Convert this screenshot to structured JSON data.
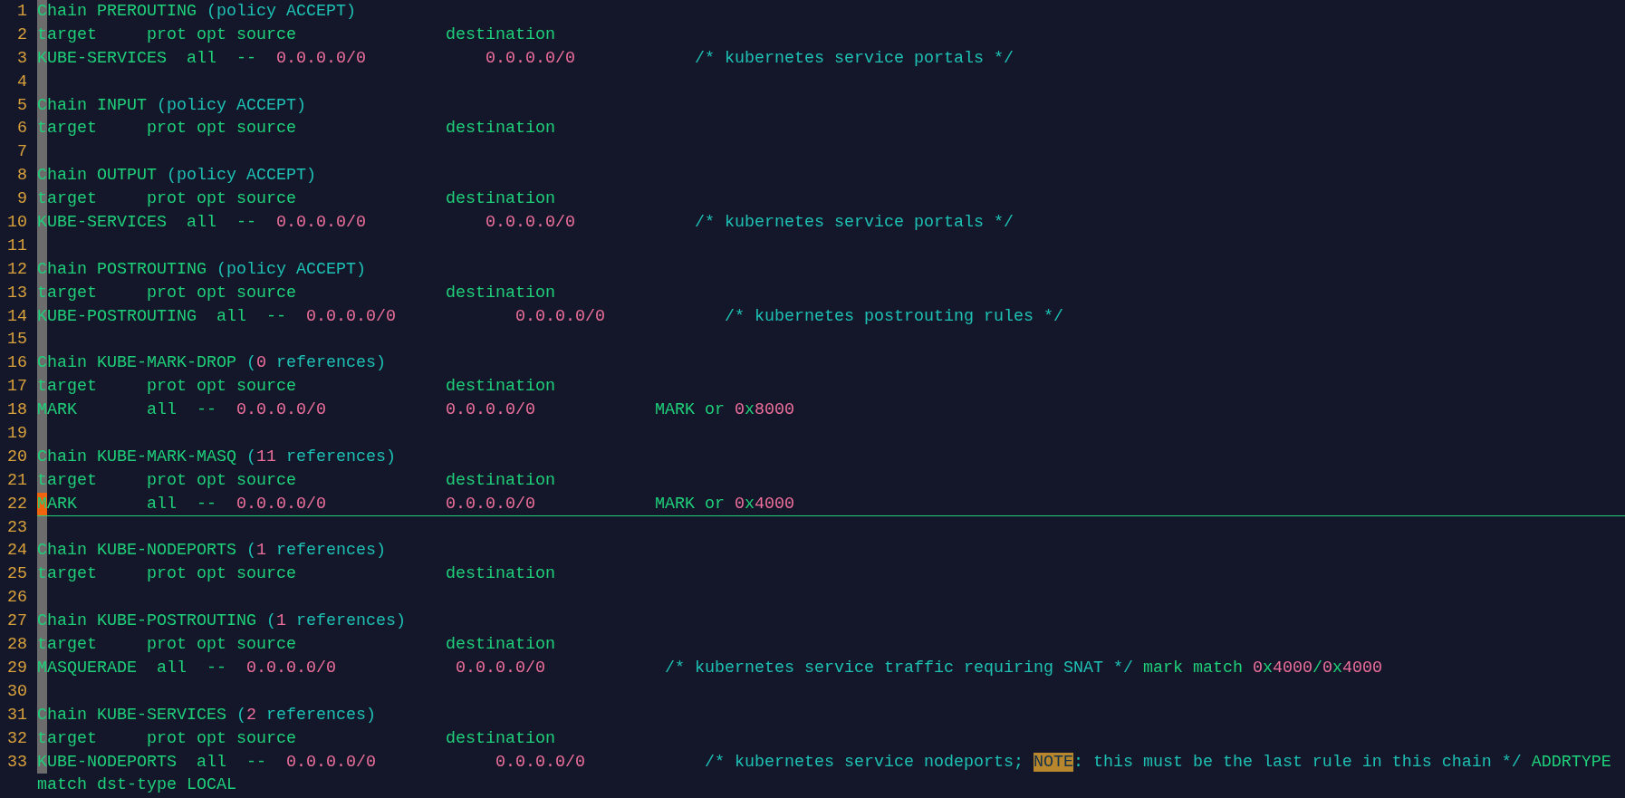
{
  "lines": [
    {
      "number": "1",
      "current": false,
      "tokens": [
        {
          "kind": "text",
          "t": "Chain PREROUTING "
        },
        {
          "kind": "comment",
          "t": "(policy ACCEPT)"
        }
      ]
    },
    {
      "number": "2",
      "current": false,
      "tokens": [
        {
          "kind": "text",
          "t": "target     prot opt source               destination"
        }
      ]
    },
    {
      "number": "3",
      "current": false,
      "tokens": [
        {
          "kind": "text",
          "t": "KUBE-SERVICES  all  --  "
        },
        {
          "kind": "number",
          "t": "0.0.0.0/0            "
        },
        {
          "kind": "number",
          "t": "0.0.0.0/0            "
        },
        {
          "kind": "comment",
          "t": "/* kubernetes service portals */"
        }
      ]
    },
    {
      "number": "4",
      "current": false
    },
    {
      "number": "5",
      "current": false,
      "tokens": [
        {
          "kind": "text",
          "t": "Chain INPUT "
        },
        {
          "kind": "comment",
          "t": "(policy ACCEPT)"
        }
      ]
    },
    {
      "number": "6",
      "current": false,
      "tokens": [
        {
          "kind": "text",
          "t": "target     prot opt source               destination"
        }
      ]
    },
    {
      "number": "7",
      "current": false
    },
    {
      "number": "8",
      "current": false,
      "tokens": [
        {
          "kind": "text",
          "t": "Chain OUTPUT "
        },
        {
          "kind": "comment",
          "t": "(policy ACCEPT)"
        }
      ]
    },
    {
      "number": "9",
      "current": false,
      "tokens": [
        {
          "kind": "text",
          "t": "target     prot opt source               destination"
        }
      ]
    },
    {
      "number": "10",
      "current": false,
      "tokens": [
        {
          "kind": "text",
          "t": "KUBE-SERVICES  all  --  "
        },
        {
          "kind": "number",
          "t": "0.0.0.0/0            "
        },
        {
          "kind": "number",
          "t": "0.0.0.0/0            "
        },
        {
          "kind": "comment",
          "t": "/* kubernetes service portals */"
        }
      ]
    },
    {
      "number": "11",
      "current": false
    },
    {
      "number": "12",
      "current": false,
      "tokens": [
        {
          "kind": "text",
          "t": "Chain POSTROUTING "
        },
        {
          "kind": "comment",
          "t": "(policy ACCEPT)"
        }
      ]
    },
    {
      "number": "13",
      "current": false,
      "tokens": [
        {
          "kind": "text",
          "t": "target     prot opt source               destination"
        }
      ]
    },
    {
      "number": "14",
      "current": false,
      "tokens": [
        {
          "kind": "text",
          "t": "KUBE-POSTROUTING  all  --  "
        },
        {
          "kind": "number",
          "t": "0.0.0.0/0            "
        },
        {
          "kind": "number",
          "t": "0.0.0.0/0            "
        },
        {
          "kind": "comment",
          "t": "/* kubernetes postrouting rules */"
        }
      ]
    },
    {
      "number": "15",
      "current": false
    },
    {
      "number": "16",
      "current": false,
      "tokens": [
        {
          "kind": "text",
          "t": "Chain KUBE-MARK-DROP "
        },
        {
          "kind": "comment",
          "t": "("
        },
        {
          "kind": "number",
          "t": "0"
        },
        {
          "kind": "comment",
          "t": " references)"
        }
      ]
    },
    {
      "number": "17",
      "current": false,
      "tokens": [
        {
          "kind": "text",
          "t": "target     prot opt source               destination"
        }
      ]
    },
    {
      "number": "18",
      "current": false,
      "tokens": [
        {
          "kind": "text",
          "t": "MARK       all  --  "
        },
        {
          "kind": "number",
          "t": "0.0.0.0/0            "
        },
        {
          "kind": "number",
          "t": "0.0.0.0/0"
        },
        {
          "kind": "text",
          "t": "            MARK or "
        },
        {
          "kind": "number",
          "t": "0"
        },
        {
          "kind": "text",
          "t": "x"
        },
        {
          "kind": "number",
          "t": "8000"
        }
      ]
    },
    {
      "number": "19",
      "current": false
    },
    {
      "number": "20",
      "current": false,
      "tokens": [
        {
          "kind": "text",
          "t": "Chain KUBE-MARK-MASQ "
        },
        {
          "kind": "comment",
          "t": "("
        },
        {
          "kind": "number",
          "t": "11"
        },
        {
          "kind": "comment",
          "t": " references)"
        }
      ]
    },
    {
      "number": "21",
      "current": false,
      "tokens": [
        {
          "kind": "text",
          "t": "target     prot opt source               destination"
        }
      ]
    },
    {
      "number": "22",
      "current": true,
      "tokens": [
        {
          "kind": "text",
          "t": "MARK       all  --  "
        },
        {
          "kind": "number",
          "t": "0.0.0.0/0            "
        },
        {
          "kind": "number",
          "t": "0.0.0.0/0"
        },
        {
          "kind": "text",
          "t": "            MARK or "
        },
        {
          "kind": "number",
          "t": "0"
        },
        {
          "kind": "text",
          "t": "x"
        },
        {
          "kind": "number",
          "t": "4000"
        }
      ]
    },
    {
      "number": "23",
      "current": false
    },
    {
      "number": "24",
      "current": false,
      "tokens": [
        {
          "kind": "text",
          "t": "Chain KUBE-NODEPORTS "
        },
        {
          "kind": "comment",
          "t": "("
        },
        {
          "kind": "number",
          "t": "1"
        },
        {
          "kind": "comment",
          "t": " references)"
        }
      ]
    },
    {
      "number": "25",
      "current": false,
      "tokens": [
        {
          "kind": "text",
          "t": "target     prot opt source               destination"
        }
      ]
    },
    {
      "number": "26",
      "current": false
    },
    {
      "number": "27",
      "current": false,
      "tokens": [
        {
          "kind": "text",
          "t": "Chain KUBE-POSTROUTING "
        },
        {
          "kind": "comment",
          "t": "("
        },
        {
          "kind": "number",
          "t": "1"
        },
        {
          "kind": "comment",
          "t": " references)"
        }
      ]
    },
    {
      "number": "28",
      "current": false,
      "tokens": [
        {
          "kind": "text",
          "t": "target     prot opt source               destination"
        }
      ]
    },
    {
      "number": "29",
      "current": false,
      "tokens": [
        {
          "kind": "text",
          "t": "MASQUERADE  all  --  "
        },
        {
          "kind": "number",
          "t": "0.0.0.0/0            "
        },
        {
          "kind": "number",
          "t": "0.0.0.0/0            "
        },
        {
          "kind": "comment",
          "t": "/* kubernetes service traffic requiring SNAT */"
        },
        {
          "kind": "text",
          "t": " mark match "
        },
        {
          "kind": "number",
          "t": "0"
        },
        {
          "kind": "text",
          "t": "x"
        },
        {
          "kind": "number",
          "t": "4000"
        },
        {
          "kind": "text",
          "t": "/"
        },
        {
          "kind": "number",
          "t": "0"
        },
        {
          "kind": "text",
          "t": "x"
        },
        {
          "kind": "number",
          "t": "4000"
        }
      ]
    },
    {
      "number": "30",
      "current": false
    },
    {
      "number": "31",
      "current": false,
      "tokens": [
        {
          "kind": "text",
          "t": "Chain KUBE-SERVICES "
        },
        {
          "kind": "comment",
          "t": "("
        },
        {
          "kind": "number",
          "t": "2"
        },
        {
          "kind": "comment",
          "t": " references)"
        }
      ]
    },
    {
      "number": "32",
      "current": false,
      "tokens": [
        {
          "kind": "text",
          "t": "target     prot opt source               destination"
        }
      ]
    },
    {
      "number": "33",
      "current": false,
      "tokens": [
        {
          "kind": "text",
          "t": "KUBE-NODEPORTS  all  --  "
        },
        {
          "kind": "number",
          "t": "0.0.0.0/0            "
        },
        {
          "kind": "number",
          "t": "0.0.0.0/0            "
        },
        {
          "kind": "comment",
          "t": "/* kubernetes service nodeports; "
        },
        {
          "kind": "todo",
          "t": "NOTE"
        },
        {
          "kind": "comment",
          "t": ": this must be the last rule in this chain */"
        },
        {
          "kind": "text",
          "t": " ADDRTYPE"
        }
      ],
      "continuation": [
        {
          "kind": "text",
          "t": "match dst-type LOCAL"
        }
      ]
    }
  ]
}
